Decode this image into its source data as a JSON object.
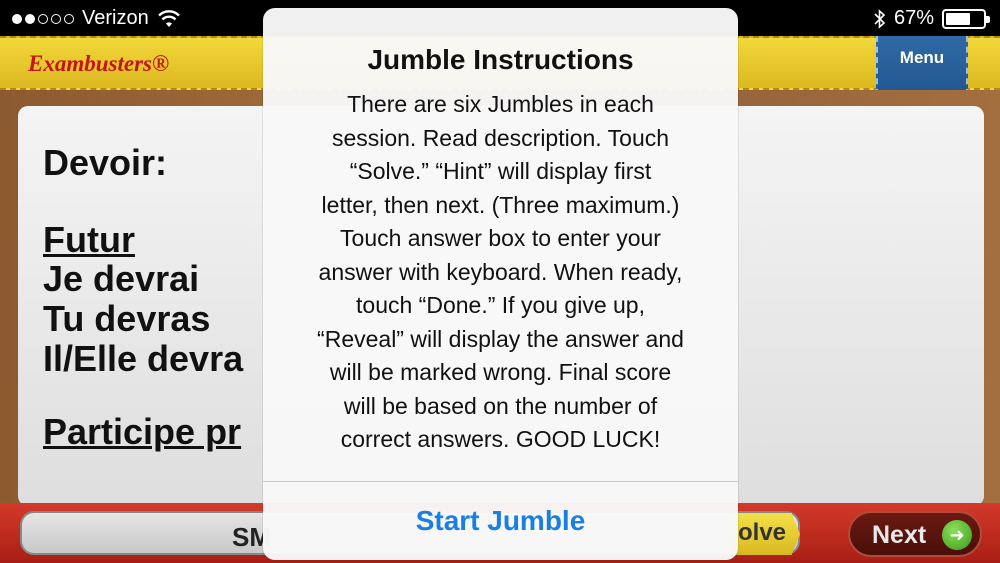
{
  "status_bar": {
    "carrier": "Verizon",
    "battery_percent": "67%",
    "battery_level": 0.67,
    "signal_dots_filled": 2,
    "signal_dots_total": 5
  },
  "header": {
    "brand": "Exambusters®",
    "menu_label": "Menu"
  },
  "card": {
    "heading": "Devoir:",
    "tense_label": "Futur",
    "lines": [
      "Je devrai",
      "Tu devras",
      "Il/Elle devra"
    ],
    "participle_label": "Participe pr"
  },
  "bottom_bar": {
    "answer_label": "SM",
    "solve_label": "olve",
    "next_label": "Next"
  },
  "dialog": {
    "title": "Jumble Instructions",
    "lines": [
      "There are six Jumbles in each",
      "session. Read description. Touch",
      "“Solve.” “Hint” will display first",
      "letter, then next. (Three maximum.)",
      "Touch answer box to enter your",
      "answer with keyboard. When ready,",
      "touch “Done.” If you give up,",
      "“Reveal” will display the answer and",
      "will be marked wrong. Final score",
      "will be based on the number of",
      "correct answers. GOOD LUCK!"
    ],
    "button_label": "Start Jumble"
  },
  "colors": {
    "header_yellow": "#e8c82c",
    "brand_red": "#c4151c",
    "menu_blue": "#2a5f9a",
    "bottom_red": "#c02a1c",
    "link_blue": "#1a7fe0"
  }
}
